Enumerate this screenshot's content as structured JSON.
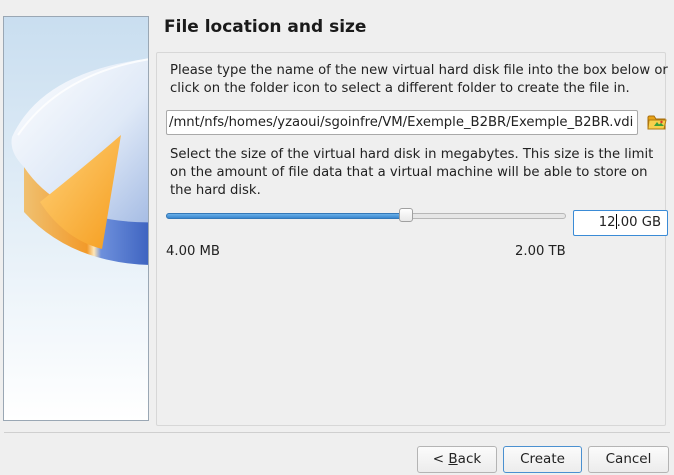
{
  "page": {
    "title": "File location and size"
  },
  "location": {
    "description": "Please type the name of the new virtual hard disk file into the box below or click on the folder icon to select a different folder to create the file in.",
    "path_value": "/mnt/nfs/homes/yzaoui/sgoinfre/VM/Exemple_B2BR/Exemple_B2BR.vdi",
    "folder_icon": "folder-open-icon"
  },
  "size": {
    "description": "Select the size of the virtual hard disk in megabytes. This size is the limit on the amount of file data that a virtual machine will be able to store on the hard disk.",
    "slider_fraction": 0.6,
    "value_before_caret": "12",
    "value_after_caret": ".00 GB",
    "min_label": "4.00 MB",
    "max_label": "2.00 TB"
  },
  "buttons": {
    "back_mnemonic": "B",
    "back_rest": "ack",
    "back_prefix": "< ",
    "create": "Create",
    "cancel": "Cancel"
  },
  "colors": {
    "accent": "#3a87cf",
    "disk_orange": "#f5a623",
    "disk_blue": "#3d6fd1"
  }
}
